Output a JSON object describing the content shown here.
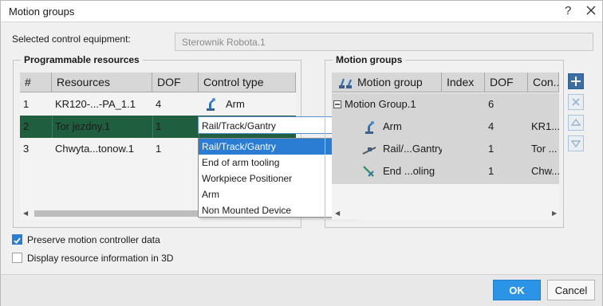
{
  "window": {
    "title": "Motion groups",
    "help_glyph": "?",
    "close_glyph": "×"
  },
  "selected": {
    "label": "Selected control equipment:",
    "value": "Sterownik Robota.1"
  },
  "programmable": {
    "group_label": "Programmable resources",
    "headers": [
      "#",
      "Resources",
      "DOF",
      "Control type"
    ],
    "rows": [
      {
        "num": "1",
        "resource": "KR120-...-PA_1.1",
        "dof": "4",
        "control": "Arm"
      },
      {
        "num": "2",
        "resource": "Tor jezdny.1",
        "dof": "1",
        "control": "Rail/Track/Gantry"
      },
      {
        "num": "3",
        "resource": "Chwyta...tonow.1",
        "dof": "1",
        "control": ""
      }
    ],
    "dropdown_value": "Rail/Track/Gantry",
    "dropdown_options": [
      "Rail/Track/Gantry",
      "End of arm tooling",
      "Workpiece Positioner",
      "Arm",
      "Non Mounted Device"
    ]
  },
  "motion": {
    "group_label": "Motion groups",
    "headers": [
      "Motion group",
      "Index",
      "DOF",
      "Con..."
    ],
    "rows": [
      {
        "name": "Motion Group.1",
        "index": "",
        "dof": "6",
        "control": ""
      },
      {
        "name": "Arm",
        "index": "",
        "dof": "4",
        "control": "KR1..."
      },
      {
        "name": "Rail/...Gantry",
        "index": "",
        "dof": "1",
        "control": "Tor ..."
      },
      {
        "name": "End ...oling",
        "index": "",
        "dof": "1",
        "control": "Chw...c"
      }
    ],
    "tree_toggle": "−"
  },
  "options": {
    "preserve": {
      "label": "Preserve motion controller data",
      "checked": true
    },
    "display3d": {
      "label": "Display resource information in 3D",
      "checked": false
    }
  },
  "buttons": {
    "ok": "OK",
    "cancel": "Cancel"
  },
  "colors": {
    "accent": "#2b94e6",
    "selected_row": "#1f5e3f",
    "dropdown_highlight": "#2b7cd3"
  }
}
